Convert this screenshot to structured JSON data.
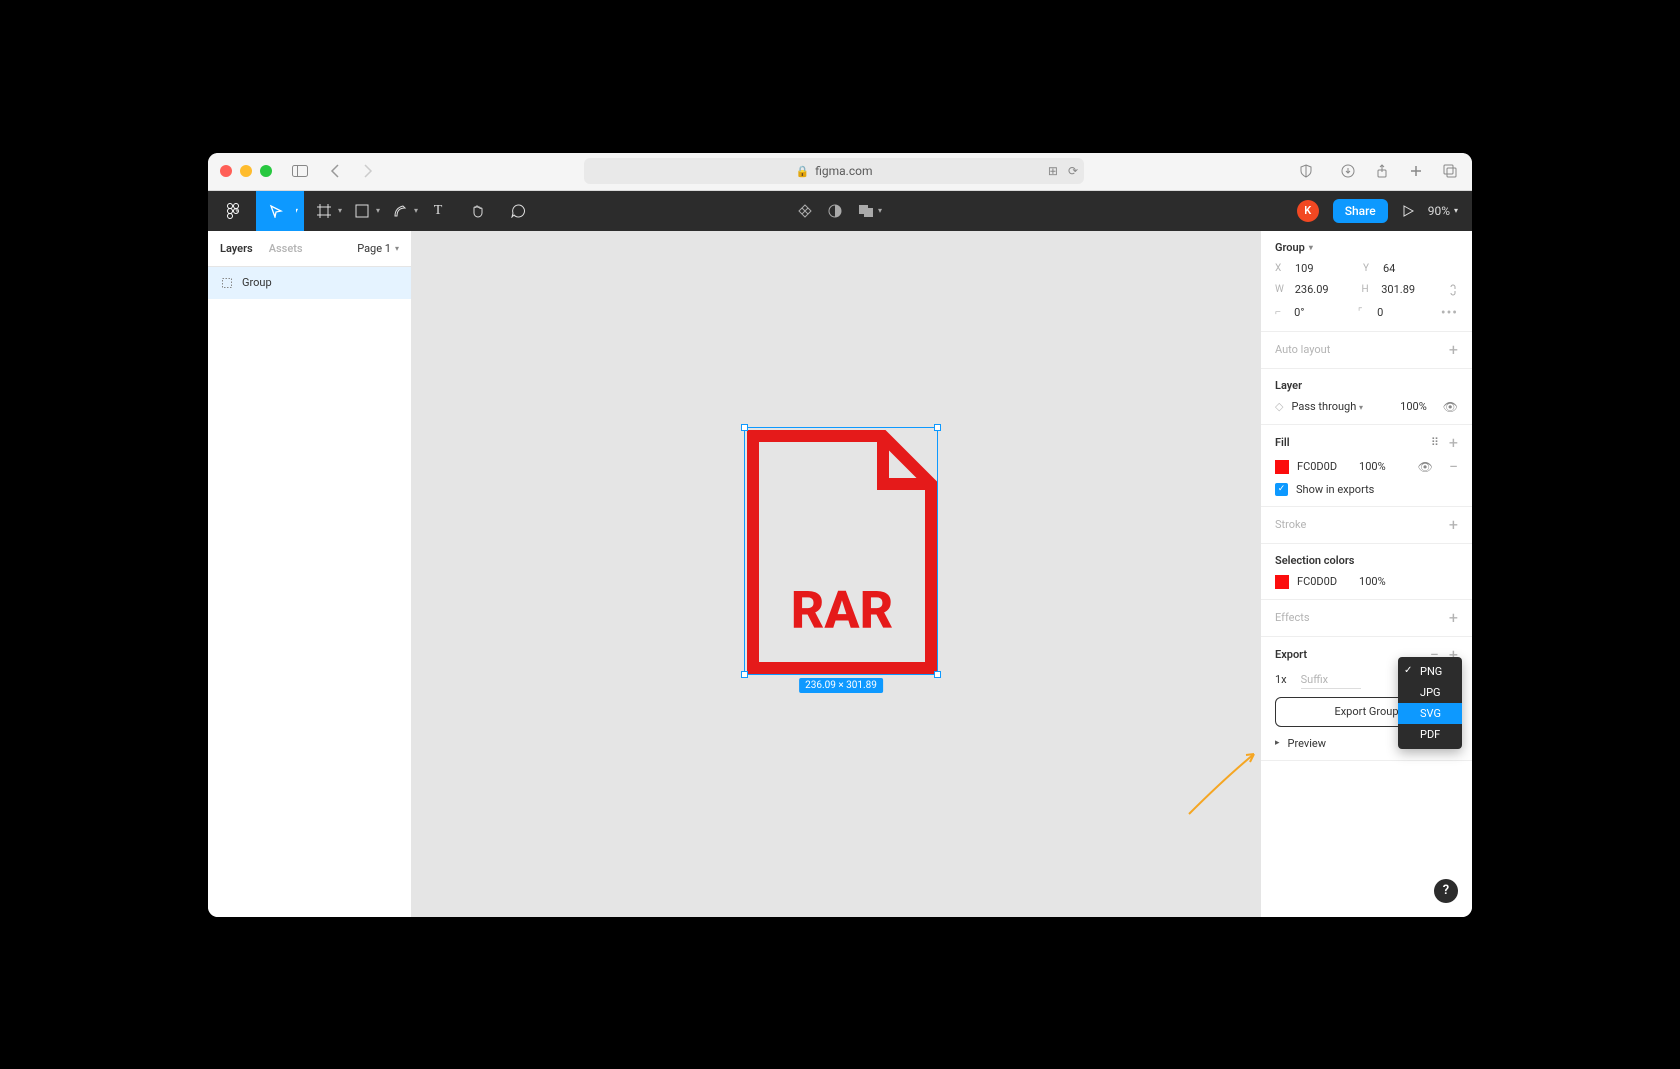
{
  "browser": {
    "url_host": "figma.com"
  },
  "toolbar": {
    "avatar_initial": "K",
    "share_label": "Share",
    "zoom": "90%"
  },
  "left_panel": {
    "tabs": {
      "layers": "Layers",
      "assets": "Assets"
    },
    "page_label": "Page 1",
    "layer_name": "Group"
  },
  "canvas": {
    "dim_badge": "236.09 × 301.89",
    "artwork_text": "RAR"
  },
  "design": {
    "selection_label": "Group",
    "x_label": "X",
    "x": "109",
    "y_label": "Y",
    "y": "64",
    "w_label": "W",
    "w": "236.09",
    "h_label": "H",
    "h": "301.89",
    "angle_label": "⌐",
    "angle": "0°",
    "radius_label": "⌜",
    "radius": "0",
    "auto_layout": "Auto layout",
    "layer_section": "Layer",
    "blend_mode": "Pass through",
    "opacity": "100%",
    "fill_section": "Fill",
    "fill_hex": "FC0D0D",
    "fill_opacity": "100%",
    "show_in_exports": "Show in exports",
    "stroke_section": "Stroke",
    "selection_colors_section": "Selection colors",
    "sel_color_hex": "FC0D0D",
    "sel_color_opacity": "100%",
    "effects_section": "Effects",
    "export_section": "Export",
    "export_scale": "1x",
    "export_suffix_placeholder": "Suffix",
    "export_button": "Export Group",
    "preview_label": "Preview",
    "format_options": [
      "PNG",
      "JPG",
      "SVG",
      "PDF"
    ],
    "format_selected": "PNG",
    "format_hovered": "SVG"
  }
}
